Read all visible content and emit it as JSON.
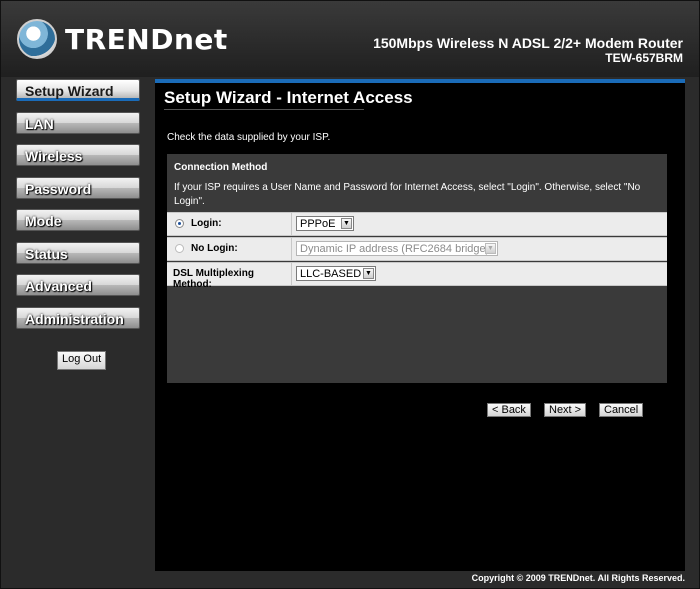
{
  "header": {
    "logo_text": "TRENDnet",
    "product_name": "150Mbps Wireless N ADSL 2/2+ Modem Router",
    "model": "TEW-657BRM"
  },
  "sidebar": {
    "items": [
      {
        "label": "Setup Wizard",
        "active": true
      },
      {
        "label": "LAN"
      },
      {
        "label": "Wireless"
      },
      {
        "label": "Password"
      },
      {
        "label": "Mode"
      },
      {
        "label": "Status"
      },
      {
        "label": "Advanced"
      },
      {
        "label": "Administration"
      }
    ],
    "logout_label": "Log Out"
  },
  "main": {
    "title": "Setup Wizard - Internet Access",
    "instruction": "Check the data supplied by your ISP.",
    "connection": {
      "heading": "Connection Method",
      "description": "If your ISP requires a User Name and Password for Internet Access, select \"Login\". Otherwise, select \"No Login\".",
      "login_label": "Login:",
      "login_value": "PPPoE",
      "login_selected": true,
      "nologin_label": "No Login:",
      "nologin_value": "Dynamic IP address (RFC2684 bridge)",
      "multiplex_label": "DSL Multiplexing Method:",
      "multiplex_value": "LLC-BASED"
    },
    "buttons": {
      "back": "< Back",
      "next": "Next >",
      "cancel": "Cancel"
    }
  },
  "footer": {
    "copyright": "Copyright © 2009 TRENDnet. All Rights Reserved."
  },
  "colors": {
    "accent": "#1a6bb8",
    "background": "#2b2b2b",
    "panel": "#3a3a3a"
  }
}
